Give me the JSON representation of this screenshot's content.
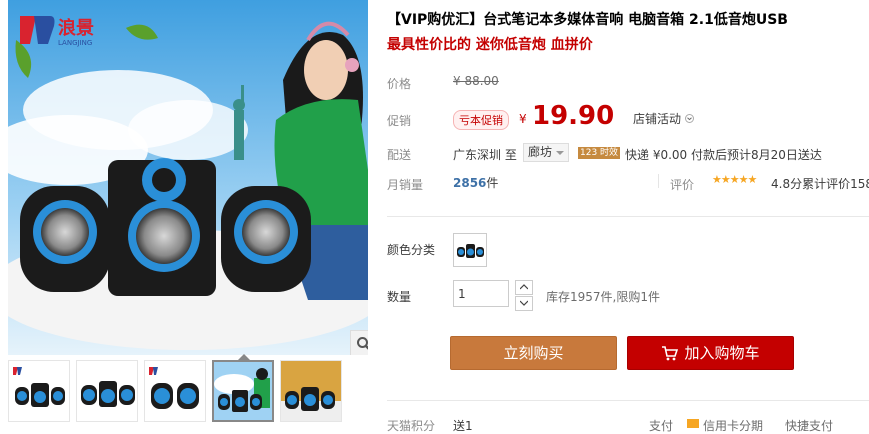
{
  "product": {
    "title": "【VIP购优汇】台式笔记本多媒体音响 电脑音箱 2.1低音炮USB",
    "subtitle": "最具性价比的 迷你低音炮 血拼价"
  },
  "price": {
    "label": "价格",
    "original": "¥ 88.00"
  },
  "promo": {
    "label": "促销",
    "tag": "亏本促销",
    "currency": "¥",
    "price": "19.90",
    "shop_event": "店铺活动"
  },
  "shipping": {
    "label": "配送",
    "from": "广东深圳  至",
    "to": "廊坊",
    "badge": "123 时效",
    "info": "快递 ¥0.00 付款后预计8月20日送达"
  },
  "sales": {
    "label": "月销量",
    "value": "2856",
    "unit": "件",
    "rating_label": "评价",
    "stars": "★★★★★",
    "rating": "4.8分累计评价158"
  },
  "options": {
    "color_label": "颜色分类",
    "qty_label": "数量",
    "qty_value": "1",
    "stock": "库存1957件,限购1件"
  },
  "actions": {
    "buy_now": "立刻购买",
    "add_to_cart": "加入购物车"
  },
  "bottom": {
    "points_label": "天猫积分",
    "points_value": "送1",
    "pay_label": "支付",
    "pay_credit": "信用卡分期",
    "pay_quick": "快捷支付"
  },
  "brand": {
    "name": "浪景",
    "sub": "LANGJING"
  },
  "icons": {
    "zoom": "search-icon",
    "dropdown": "chevron-down-icon",
    "cart": "cart-icon"
  },
  "colors": {
    "accent_red": "#c40000",
    "buy_orange": "#c8793c",
    "link_blue": "#3e71a7",
    "star_gold": "#f6a623"
  }
}
